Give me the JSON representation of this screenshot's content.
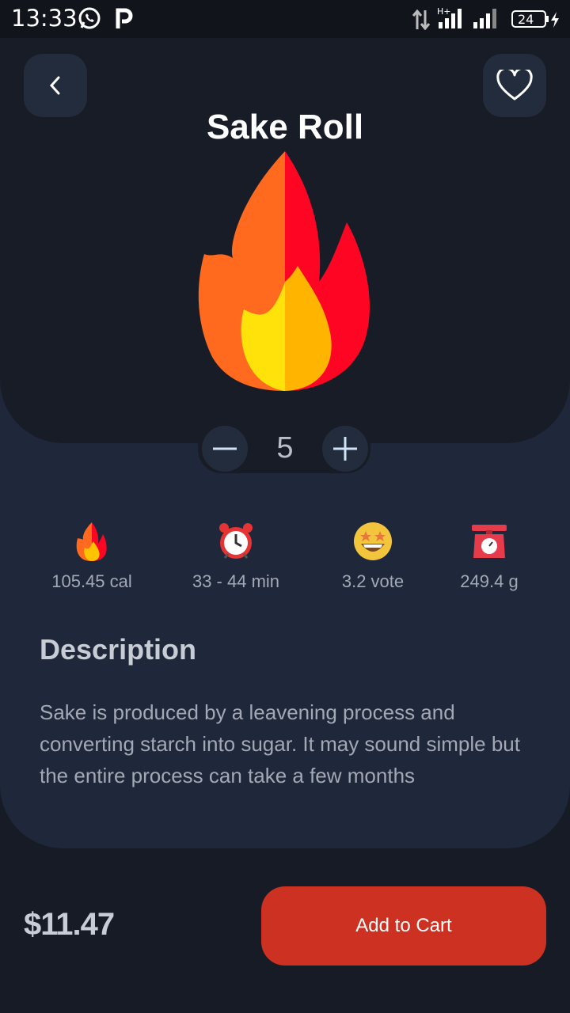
{
  "status_bar": {
    "time": "13:33",
    "battery": "24",
    "icons": [
      "whatsapp-icon",
      "parking-app-icon",
      "data-arrows-icon",
      "signal-h-plus-icon",
      "signal-icon",
      "battery-icon",
      "charging-icon"
    ]
  },
  "header": {
    "title": "Sake Roll",
    "back_icon": "chevron-left-icon",
    "favorite_icon": "heart-outline-icon"
  },
  "hero": {
    "icon": "flame-icon"
  },
  "stepper": {
    "quantity": "5",
    "minus_icon": "minus-icon",
    "plus_icon": "plus-icon"
  },
  "stats": [
    {
      "icon": "flame-icon",
      "label": "105.45 cal"
    },
    {
      "icon": "alarm-clock-icon",
      "label": "33 - 44 min"
    },
    {
      "icon": "star-eyes-emoji-icon",
      "label": "3.2 vote"
    },
    {
      "icon": "kitchen-scale-icon",
      "label": "249.4 g"
    }
  ],
  "description": {
    "title": "Description",
    "text": "Sake is produced by a leavening process and converting starch into sugar. It may sound simple but the entire process can take a few months"
  },
  "footer": {
    "price": "$11.47",
    "cart_label": "Add to Cart"
  },
  "colors": {
    "background": "#161b26",
    "panel": "#181c26",
    "card": "#1f283a",
    "accent": "#cd3121"
  }
}
